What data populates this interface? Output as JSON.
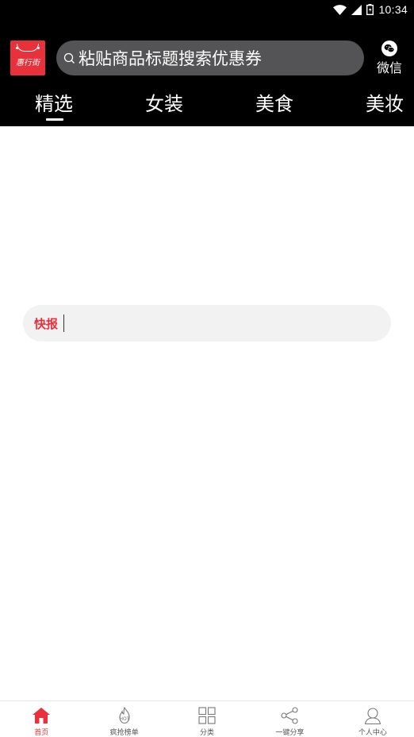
{
  "status_bar": {
    "time": "10:34",
    "icons": [
      "wifi-icon",
      "signal-icon",
      "battery-icon"
    ]
  },
  "header": {
    "logo_text": "惠行街",
    "search": {
      "placeholder": "粘贴商品标题搜索优惠券"
    },
    "wechat_label": "微信",
    "tabs": [
      {
        "label": "精选",
        "active": true
      },
      {
        "label": "女装",
        "active": false
      },
      {
        "label": "美食",
        "active": false
      },
      {
        "label": "美妆",
        "active": false
      }
    ]
  },
  "notice": {
    "label": "快报"
  },
  "bottom_nav": {
    "items": [
      {
        "label": "首页",
        "icon": "home-icon",
        "active": true
      },
      {
        "label": "疯抢榜单",
        "icon": "fire-icon",
        "active": false
      },
      {
        "label": "分类",
        "icon": "grid-icon",
        "active": false
      },
      {
        "label": "一键分享",
        "icon": "share-icon",
        "active": false
      },
      {
        "label": "个人中心",
        "icon": "user-icon",
        "active": false
      }
    ]
  },
  "colors": {
    "accent": "#e8313a",
    "header_bg": "#000000",
    "search_bg": "#545456",
    "notice_bg": "#f2f2f2",
    "wechat_green": "#ffffff"
  }
}
